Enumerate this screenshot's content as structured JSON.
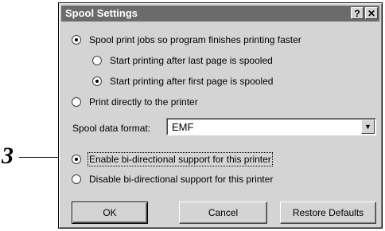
{
  "callout": {
    "number": "3"
  },
  "dialog": {
    "title": "Spool Settings",
    "help_button": "?",
    "close_button": "✕",
    "options": {
      "spool": "Spool print jobs so program finishes printing faster",
      "after_last": "Start printing after last page is spooled",
      "after_first": "Start printing after first page is spooled",
      "direct": "Print directly to the printer",
      "enable_bidi": "Enable bi-directional support for this printer",
      "disable_bidi": "Disable bi-directional support for this printer"
    },
    "spool_format": {
      "label": "Spool data format:",
      "value": "EMF"
    },
    "buttons": {
      "ok": "OK",
      "cancel": "Cancel",
      "restore": "Restore Defaults"
    }
  }
}
